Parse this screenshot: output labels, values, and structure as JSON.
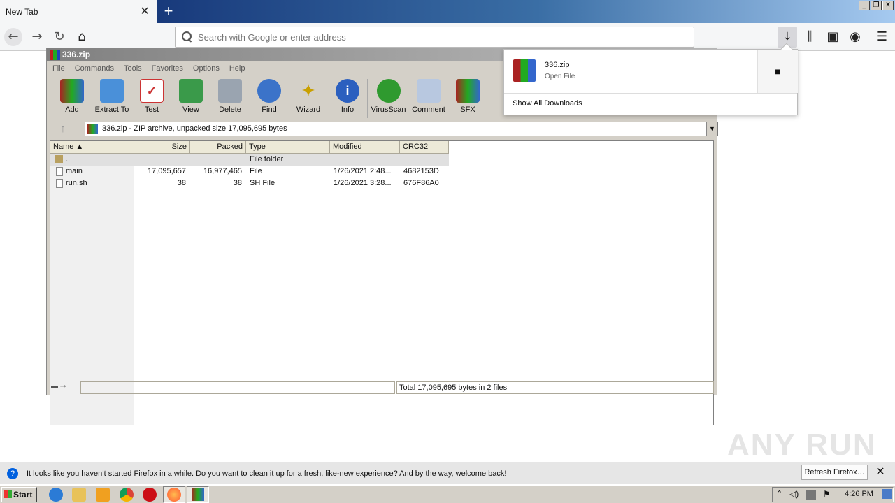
{
  "browser": {
    "tab_title": "New Tab",
    "search_placeholder": "Search with Google or enter address"
  },
  "winrar": {
    "window_title": "336.zip",
    "menu": [
      "File",
      "Commands",
      "Tools",
      "Favorites",
      "Options",
      "Help"
    ],
    "toolbar": [
      "Add",
      "Extract To",
      "Test",
      "View",
      "Delete",
      "Find",
      "Wizard",
      "Info",
      "VirusScan",
      "Comment",
      "SFX"
    ],
    "address": "336.zip - ZIP archive, unpacked size 17,095,695 bytes",
    "columns": [
      "Name",
      "Size",
      "Packed",
      "Type",
      "Modified",
      "CRC32"
    ],
    "rows": [
      {
        "name": "..",
        "size": "",
        "packed": "",
        "type": "File folder",
        "modified": "",
        "crc": ""
      },
      {
        "name": "main",
        "size": "17,095,657",
        "packed": "16,977,465",
        "type": "File",
        "modified": "1/26/2021 2:48...",
        "crc": "4682153D"
      },
      {
        "name": "run.sh",
        "size": "38",
        "packed": "38",
        "type": "SH File",
        "modified": "1/26/2021 3:28...",
        "crc": "676F86A0"
      }
    ],
    "status": "Total 17,095,695 bytes in 2 files"
  },
  "downloads": {
    "file_name": "336.zip",
    "file_action": "Open File",
    "show_all": "Show All Downloads"
  },
  "notification": {
    "message": "It looks like you haven’t started Firefox in a while. Do you want to clean it up for a fresh, like-new experience? And by the way, welcome back!",
    "button": "Refresh Firefox…"
  },
  "taskbar": {
    "start": "Start",
    "clock": "4:26 PM"
  },
  "watermark": "ANY RUN",
  "colors": {
    "titlebar": "#0a246a",
    "accent": "#0060df"
  }
}
